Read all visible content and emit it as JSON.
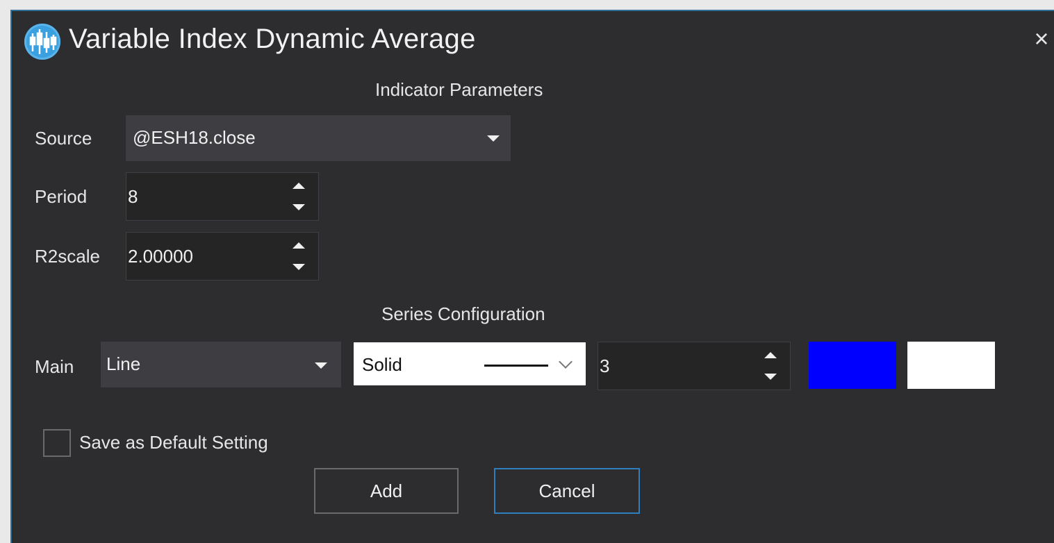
{
  "window": {
    "title": "Variable Index Dynamic Average",
    "close_glyph": "×",
    "app_icon": "candlestick-chart-icon"
  },
  "indicator_parameters": {
    "heading": "Indicator Parameters",
    "source": {
      "label": "Source",
      "value": "@ESH18.close"
    },
    "period": {
      "label": "Period",
      "value": "8"
    },
    "r2scale": {
      "label": "R2scale",
      "value": "2.00000"
    }
  },
  "series_configuration": {
    "heading": "Series Configuration",
    "main": {
      "label": "Main",
      "plot_type": "Line",
      "line_style": "Solid",
      "width": "3",
      "color_primary": "#0000ff",
      "color_secondary": "#ffffff"
    }
  },
  "footer": {
    "save_default_label": "Save as Default Setting",
    "save_default_checked": false,
    "add_label": "Add",
    "cancel_label": "Cancel"
  },
  "theme": {
    "background": "#2d2d30",
    "accent": "#2f6e97"
  }
}
